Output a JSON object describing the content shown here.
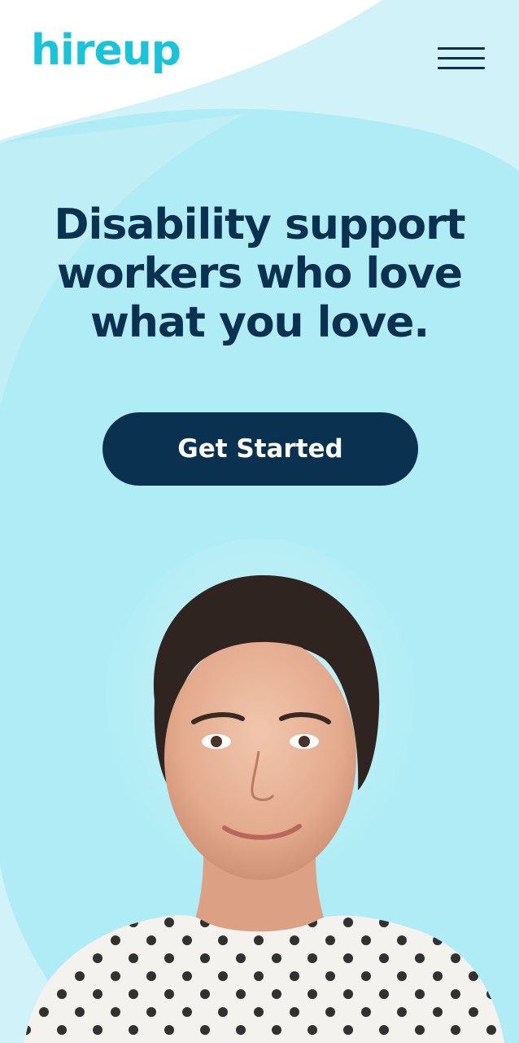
{
  "brand": {
    "logo_text": "hireup"
  },
  "header": {
    "menu_icon": "hamburger-menu-icon"
  },
  "hero": {
    "title": "Disability support workers who love what you love.",
    "cta_label": "Get Started"
  },
  "colors": {
    "brand_teal": "#19c3d9",
    "navy": "#0b3150",
    "hero_bg": "#b0ecf5",
    "hero_bg_light": "#d0f2f8",
    "white": "#ffffff"
  }
}
